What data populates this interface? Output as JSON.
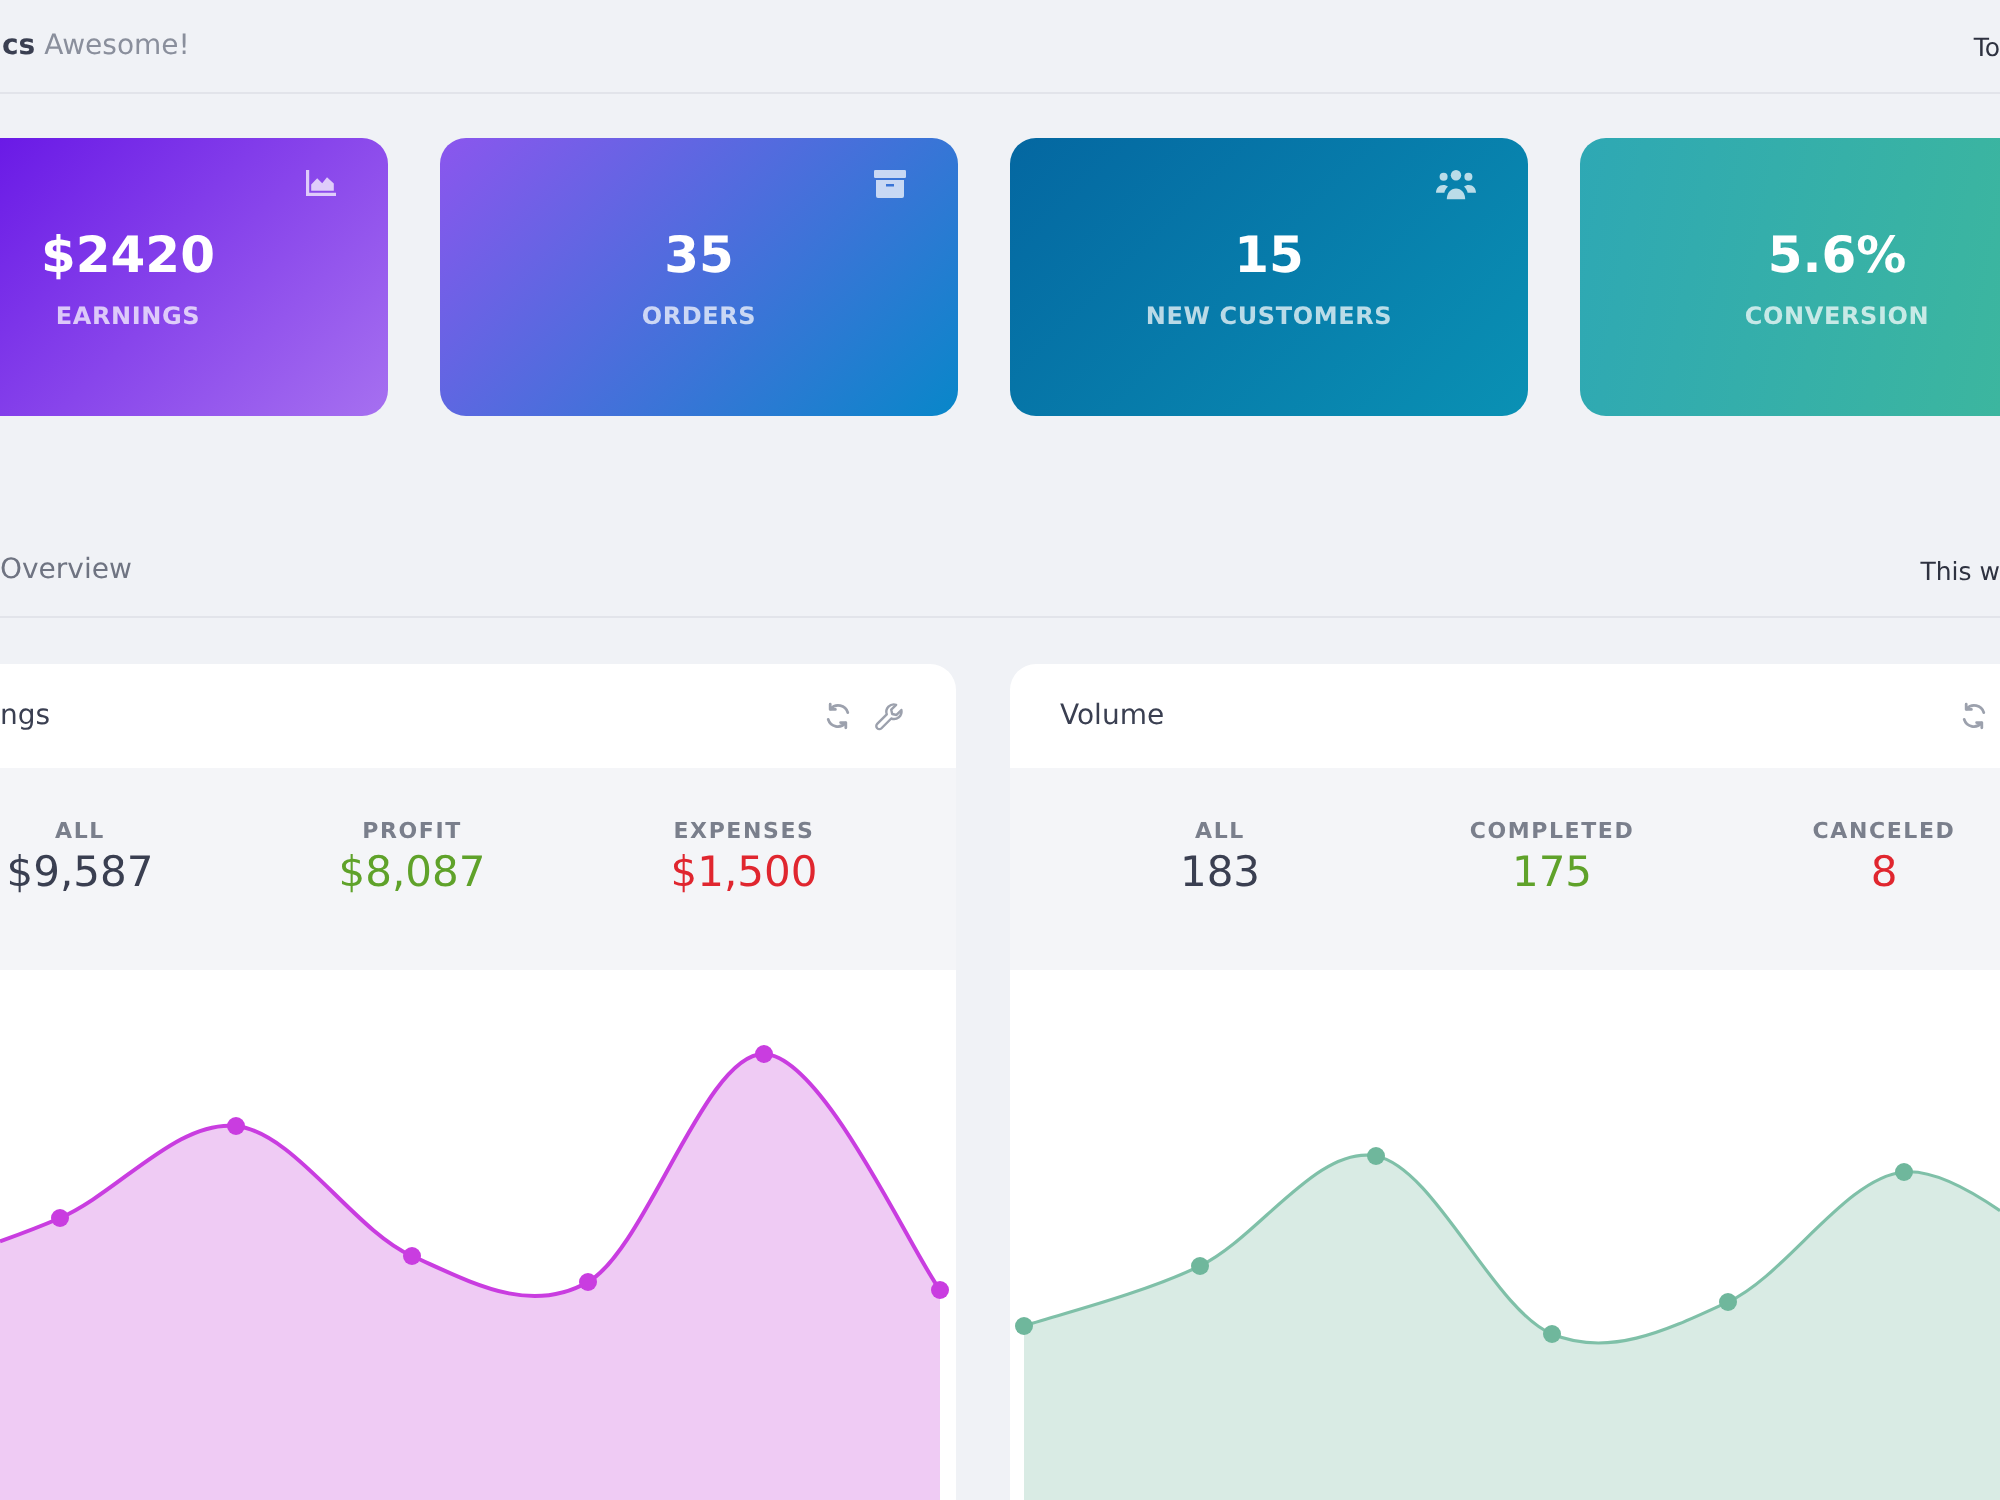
{
  "header": {
    "title": "**cs** Awesome!",
    "period": "To"
  },
  "cards": [
    {
      "value": "$2420",
      "label": "EARNINGS"
    },
    {
      "value": "35",
      "label": "ORDERS"
    },
    {
      "value": "15",
      "label": "NEW CUSTOMERS"
    },
    {
      "value": "5.6%",
      "label": "CONVERSION"
    }
  ],
  "overview": {
    "title": "Overview",
    "period": "This w"
  },
  "panels": [
    {
      "title": "ngs",
      "stats": [
        {
          "label": "ALL",
          "value": "$9,587",
          "color": "#3a3f51"
        },
        {
          "label": "PROFIT",
          "value": "$8,087",
          "color": "#5fa22a"
        },
        {
          "label": "EXPENSES",
          "value": "$1,500",
          "color": "#e0262f"
        }
      ]
    },
    {
      "title": "Volume",
      "stats": [
        {
          "label": "ALL",
          "value": "183",
          "color": "#3a3f51"
        },
        {
          "label": "COMPLETED",
          "value": "175",
          "color": "#5fa22a"
        },
        {
          "label": "CANCELED",
          "value": "8",
          "color": "#e0262f"
        }
      ]
    }
  ]
}
